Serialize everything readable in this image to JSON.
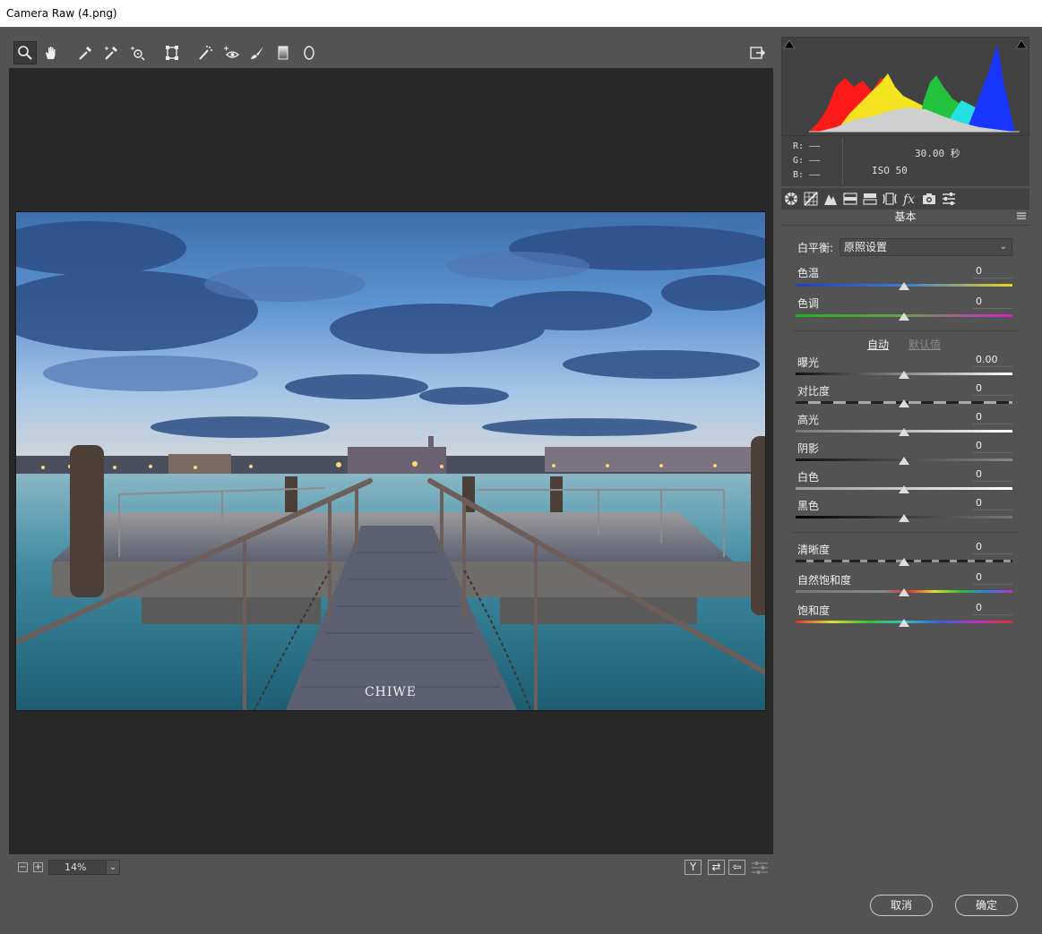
{
  "window": {
    "title": "Camera Raw (4.png)"
  },
  "colors": {
    "canvas_bg": "#282828",
    "panel_bg": "#535353",
    "dark_panel": "#424242"
  },
  "toolbar": {
    "tools": [
      "zoom-tool",
      "hand-tool",
      "white-balance-tool",
      "color-sampler-tool",
      "targeted-adjustment-tool",
      "transform-tool",
      "spot-removal-tool",
      "red-eye-removal-tool",
      "adjustment-brush-tool",
      "graduated-filter-tool",
      "radial-filter-tool"
    ],
    "export_icon": "open-preferences-icon"
  },
  "photo": {
    "watermark": "CHIWE"
  },
  "bottom": {
    "zoom_value": "14%",
    "view_buttons": [
      "Y",
      "⇄",
      "⇦"
    ]
  },
  "histogram": {
    "info": {
      "r_label": "R:",
      "r_value": "——",
      "g_label": "G:",
      "g_value": "——",
      "b_label": "B:",
      "b_value": "——",
      "shutter": "30.00 秒",
      "iso": "ISO 50"
    }
  },
  "tabs": [
    "basic-tab",
    "tone-curve-tab",
    "detail-tab",
    "hsl-tab",
    "split-toning-tab",
    "lens-corrections-tab",
    "effects-tab",
    "camera-calibration-tab",
    "presets-tab"
  ],
  "panel": {
    "title": "基本",
    "wb_label": "白平衡:",
    "wb_value": "原照设置",
    "temp_label": "色温",
    "temp_value": "0",
    "tint_label": "色调",
    "tint_value": "0",
    "auto_label": "自动",
    "default_label": "默认值",
    "sliders_tone": [
      {
        "label": "曝光",
        "value": "0.00"
      },
      {
        "label": "对比度",
        "value": "0"
      },
      {
        "label": "高光",
        "value": "0"
      },
      {
        "label": "阴影",
        "value": "0"
      },
      {
        "label": "白色",
        "value": "0"
      },
      {
        "label": "黑色",
        "value": "0"
      }
    ],
    "sliders_presence": [
      {
        "label": "清晰度",
        "value": "0"
      },
      {
        "label": "自然饱和度",
        "value": "0"
      },
      {
        "label": "饱和度",
        "value": "0"
      }
    ]
  },
  "footer": {
    "cancel_label": "取消",
    "ok_label": "确定"
  }
}
